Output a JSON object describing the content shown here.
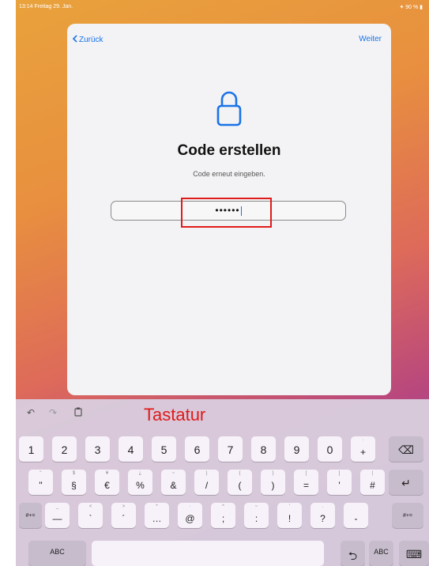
{
  "status": {
    "left": "13:14  Freitag 29. Jan.",
    "right": "✦ 90 % ▮"
  },
  "nav": {
    "back_label": "Zurück",
    "next_label": "Weiter"
  },
  "main": {
    "title": "Code erstellen",
    "subtitle": "Code erneut eingeben.",
    "code_value": "••••••"
  },
  "keyboard": {
    "annotation": "Tastatur",
    "row1": [
      {
        "main": "1"
      },
      {
        "main": "2"
      },
      {
        "main": "3"
      },
      {
        "main": "4"
      },
      {
        "main": "5"
      },
      {
        "main": "6"
      },
      {
        "main": "7"
      },
      {
        "main": "8"
      },
      {
        "main": "9"
      },
      {
        "main": "0"
      },
      {
        "main": "+",
        "alt": "·"
      }
    ],
    "row2": [
      {
        "main": "\"",
        "alt": "\""
      },
      {
        "main": "§",
        "alt": "$"
      },
      {
        "main": "€",
        "alt": "¥"
      },
      {
        "main": "%",
        "alt": "¿"
      },
      {
        "main": "&",
        "alt": "~"
      },
      {
        "main": "/",
        "alt": ")"
      },
      {
        "main": "(",
        "alt": "{"
      },
      {
        "main": ")",
        "alt": "}"
      },
      {
        "main": "=",
        "alt": "["
      },
      {
        "main": "'",
        "alt": "]"
      },
      {
        "main": "#",
        "alt": "|"
      }
    ],
    "row3": [
      {
        "main": "—",
        "alt": "_"
      },
      {
        "main": "`",
        "alt": "<"
      },
      {
        "main": "´",
        "alt": ">"
      },
      {
        "main": "…",
        "alt": "*"
      },
      {
        "main": "@",
        "alt": "·"
      },
      {
        "main": ";",
        "alt": "^"
      },
      {
        "main": ":",
        "alt": "~"
      },
      {
        "main": "!",
        "alt": "'"
      },
      {
        "main": "?",
        "alt": "."
      },
      {
        "main": "-",
        "alt": ""
      }
    ],
    "mode_key": "#+=",
    "abc_label": "ABC"
  }
}
